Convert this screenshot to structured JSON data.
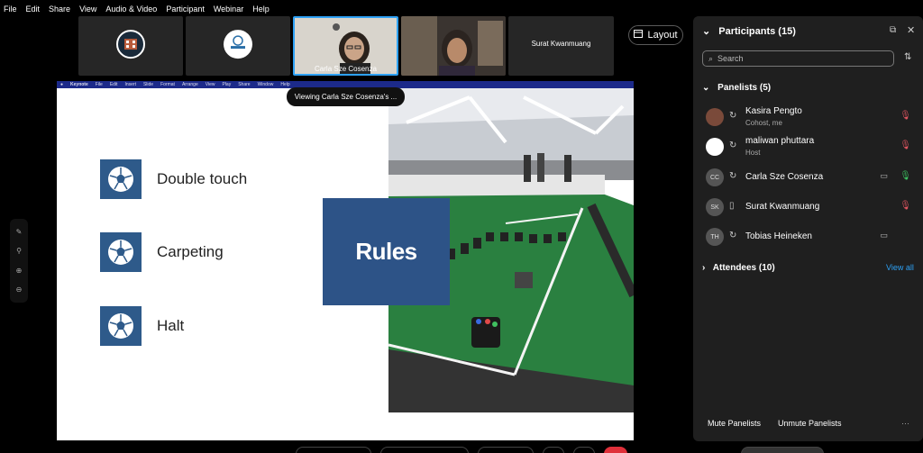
{
  "menu": [
    "File",
    "Edit",
    "Share",
    "View",
    "Audio & Video",
    "Participant",
    "Webinar",
    "Help"
  ],
  "video_tiles": [
    {
      "name": "",
      "kind": "logo-building"
    },
    {
      "name": "",
      "kind": "logo-robocup"
    },
    {
      "name": "Carla Sze Cosenza",
      "kind": "camera",
      "active": true
    },
    {
      "name": "",
      "kind": "camera"
    },
    {
      "name": "Surat Kwanmuang",
      "kind": "name-only"
    }
  ],
  "layout_button": "Layout",
  "viewing_label": "Viewing Carla Sze Cosenza's ...",
  "keynote_menu": [
    "Keynote",
    "File",
    "Edit",
    "Insert",
    "Slide",
    "Format",
    "Arrange",
    "View",
    "Play",
    "Share",
    "Window",
    "Help"
  ],
  "slide": {
    "rules": [
      "Double touch",
      "Carpeting",
      "Halt"
    ],
    "title": "Rules"
  },
  "panel": {
    "title": "Participants (15)",
    "search_placeholder": "Search",
    "panelists_header": "Panelists (5)",
    "panelists": [
      {
        "name": "Kasira Pengto",
        "role": "Cohost, me",
        "initials": "",
        "mic": "muted",
        "cam": ""
      },
      {
        "name": "maliwan phuttara",
        "role": "Host",
        "initials": "",
        "mic": "muted",
        "cam": ""
      },
      {
        "name": "Carla Sze Cosenza",
        "role": "",
        "initials": "CC",
        "mic": "on",
        "cam": "video"
      },
      {
        "name": "Surat Kwanmuang",
        "role": "",
        "initials": "SK",
        "mic": "muted",
        "cam": ""
      },
      {
        "name": "Tobias Heineken",
        "role": "",
        "initials": "TH",
        "mic": "",
        "cam": "video"
      }
    ],
    "attendees_header": "Attendees (10)",
    "view_all": "View all",
    "mute_panelists": "Mute Panelists",
    "unmute_panelists": "Unmute Panelists",
    "more": "···"
  },
  "colors": {
    "accent": "#2ea1f5",
    "muted": "#e05560",
    "mic_on": "#3cc060",
    "slide_blue": "#2d5387"
  }
}
